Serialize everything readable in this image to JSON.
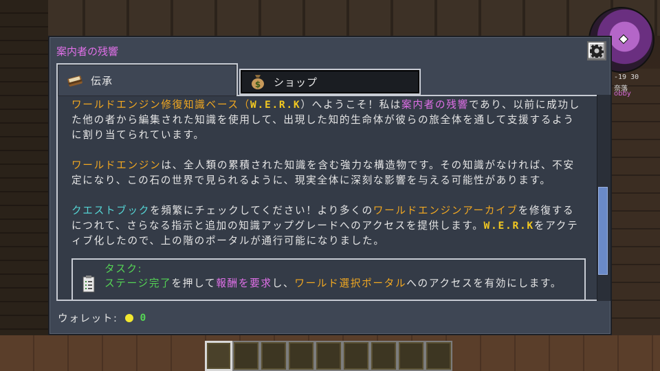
{
  "panel": {
    "title": "案内者の残響",
    "tabs": [
      {
        "label": "伝承",
        "icon": "book-icon",
        "active": true
      },
      {
        "label": "ショップ",
        "icon": "money-bag-icon",
        "active": false
      }
    ]
  },
  "lore": {
    "p1": [
      {
        "t": "ワールドエンジン修復知識ベース（",
        "c": "gold"
      },
      {
        "t": "W.E.R.K",
        "c": "yellow-bold"
      },
      {
        "t": "）へようこそ！私は",
        "c": "plain"
      },
      {
        "t": "案内者の残響",
        "c": "pink"
      },
      {
        "t": "であり、以前に成功した他の者から編集された知識を使用して、出現した知的生命体が彼らの旅全体を通して支援するように割り当てられています。",
        "c": "plain"
      }
    ],
    "p2": [
      {
        "t": "ワールドエンジン",
        "c": "gold"
      },
      {
        "t": "は、全人類の累積された知識を含む強力な構造物です。その知識がなければ、不安定になり、この石の世界で見られるように、現実全体に深刻な影響を与える可能性があります。",
        "c": "plain"
      }
    ],
    "p3": [
      {
        "t": "クエストブック",
        "c": "aqua"
      },
      {
        "t": "を頻繁にチェックしてください！より多くの",
        "c": "plain"
      },
      {
        "t": "ワールドエンジンアーカイブ",
        "c": "gold"
      },
      {
        "t": "を修復するにつれて、さらなる指示と追加の知識アップグレードへのアクセスを提供します。",
        "c": "plain"
      },
      {
        "t": "W.E.R.K",
        "c": "yellow-bold"
      },
      {
        "t": "をアクティブ化したので、上の階のポータルが通行可能になりました。",
        "c": "plain"
      }
    ]
  },
  "task": {
    "title": "タスク:",
    "body": [
      {
        "t": "ステージ完了",
        "c": "green"
      },
      {
        "t": "を押して",
        "c": "plain"
      },
      {
        "t": "報酬を要求",
        "c": "pink"
      },
      {
        "t": "し、",
        "c": "plain"
      },
      {
        "t": "ワールド選択ポータル",
        "c": "gold"
      },
      {
        "t": "へのアクセスを有効にします。",
        "c": "plain"
      }
    ]
  },
  "wallet": {
    "label": "ウォレット:",
    "amount": "0",
    "coin_color": "#f2e830"
  },
  "minimap": {
    "coords": "-19 30",
    "label": "奈落",
    "sublabel": "obby"
  },
  "hotbar": {
    "slots": 9,
    "selected": 0
  },
  "colors": {
    "gold": "#f2a821",
    "pink": "#e070e8",
    "aqua": "#55d5d5",
    "green": "#55d555",
    "panel_bg": "#3e4654"
  }
}
